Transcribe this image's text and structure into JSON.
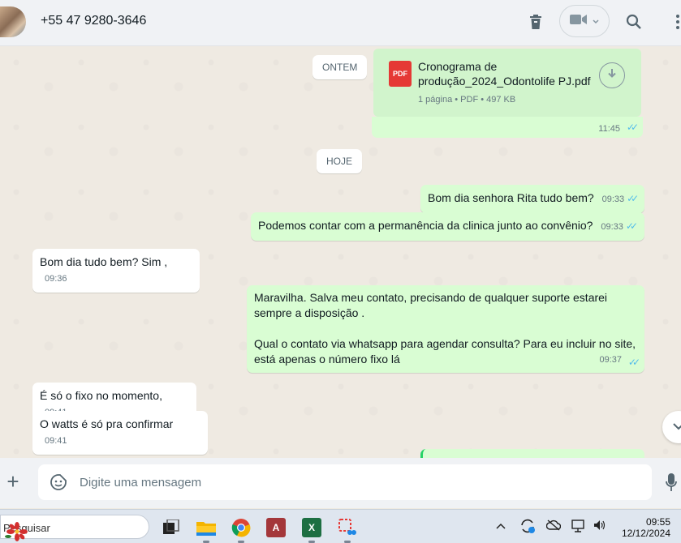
{
  "header": {
    "contact_name": "+55 47 9280-3646",
    "icons": [
      "delete-icon",
      "video-call-icon",
      "search-icon",
      "menu-icon"
    ]
  },
  "chat": {
    "date_chips": [
      "ONTEM",
      "HOJE"
    ],
    "pdf": {
      "file_name": "Cronograma de produção_2024_Odontolife PJ.pdf",
      "icon_label": "PDF",
      "meta": "1 página • PDF • 497 KB",
      "time": "11:45"
    },
    "messages": [
      {
        "dir": "out",
        "text": "Bom dia senhora Rita tudo bem?",
        "time": "09:33"
      },
      {
        "dir": "out",
        "text": "Podemos contar com a permanência da clinica junto ao convênio?",
        "time": "09:33"
      },
      {
        "dir": "in",
        "text": "Bom dia tudo bem? Sim ,",
        "time": "09:36"
      },
      {
        "dir": "out",
        "text_line1": "Maravilha. Salva meu contato, precisando de qualquer suporte estarei",
        "text_line2": "sempre a disposição .",
        "text_line3": "Qual o contato via whatsapp para agendar consulta? Para eu incluir no site,",
        "text_line4": "está apenas o número fixo lá",
        "time": "09:37"
      },
      {
        "dir": "in",
        "text": "É só o fixo no momento,",
        "time": "09:41"
      },
      {
        "dir": "in",
        "text": "O watts é só pra confirmar",
        "time": "09:41"
      }
    ]
  },
  "composer": {
    "placeholder": "Digite uma mensagem"
  },
  "taskbar": {
    "search_label": "Pesquisar",
    "apps": [
      "task-view",
      "file-explorer",
      "chrome",
      "access",
      "excel",
      "snipping-tool"
    ],
    "time": "09:55",
    "date": "12/12/2024"
  },
  "colors": {
    "outgoing_bubble": "#d9fdd3",
    "incoming_bubble": "#ffffff",
    "read_ticks": "#53bdeb",
    "chat_bg": "#efeae2"
  }
}
